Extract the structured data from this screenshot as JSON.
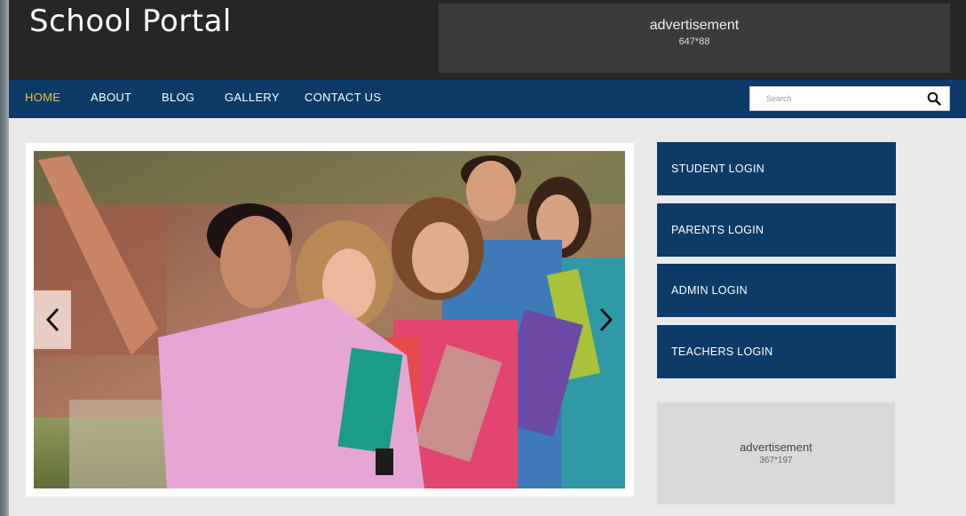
{
  "header": {
    "site_title": "School Portal",
    "ad_top": {
      "label": "advertisement",
      "size": "647*88"
    }
  },
  "nav": {
    "items": [
      {
        "label": "HOME",
        "active": true
      },
      {
        "label": "ABOUT"
      },
      {
        "label": "BLOG"
      },
      {
        "label": "GALLERY"
      },
      {
        "label": "CONTACT US"
      }
    ],
    "search": {
      "placeholder": "Search",
      "value": "",
      "icon": "search-icon"
    }
  },
  "slider": {
    "image_alt": "Group of smiling students holding notebooks",
    "prev_icon": "chevron-left-icon",
    "next_icon": "chevron-right-icon"
  },
  "logins": [
    {
      "label": "STUDENT LOGIN"
    },
    {
      "label": "PARENTS LOGIN"
    },
    {
      "label": "ADMIN LOGIN"
    },
    {
      "label": "TEACHERS LOGIN"
    }
  ],
  "ad_side": {
    "label": "advertisement",
    "size": "367*197"
  },
  "colors": {
    "header_bg": "#262626",
    "nav_bg": "#0d3a66",
    "nav_active": "#f2c232",
    "login_bg": "#0d3a66"
  }
}
